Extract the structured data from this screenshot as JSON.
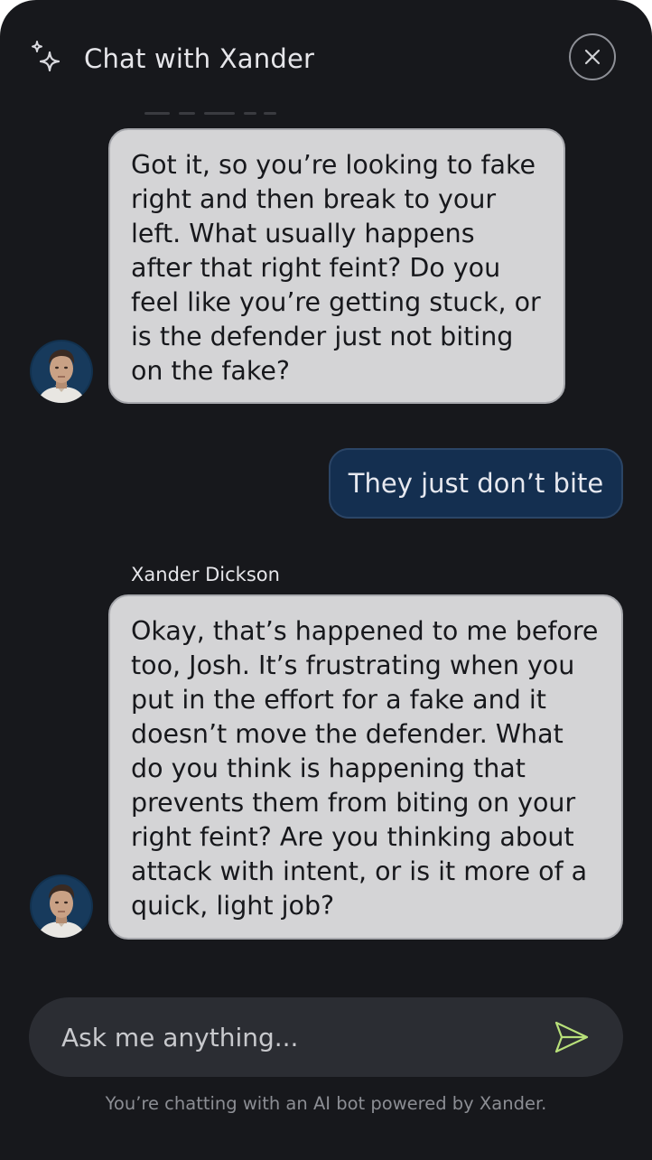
{
  "header": {
    "title": "Chat with Xander",
    "icon": "sparkle-icon",
    "close_icon": "close-icon"
  },
  "messages": [
    {
      "role": "bot",
      "text": "Got it, so you’re looking to fake right and then break to your left. What usually happens after that right feint? Do you feel like you’re getting stuck, or is the defender just not biting on the fake?"
    },
    {
      "role": "user",
      "text": "They just don’t bite"
    },
    {
      "role": "bot",
      "sender": "Xander Dickson",
      "text": "Okay, that’s happened to me before too, Josh. It’s frustrating when you put in the effort for a fake and it doesn’t move the defender. What do you think is happening that prevents them from biting on your right feint? Are you thinking about attack with intent, or is it more of a quick, light job?"
    }
  ],
  "input": {
    "placeholder": "Ask me anything...",
    "value": "",
    "send_icon": "send-icon"
  },
  "footer": "You’re chatting with an AI bot powered by Xander.",
  "colors": {
    "background": "#17181c",
    "bot_bubble": "#d4d4d6",
    "user_bubble": "#142f50",
    "send_accent": "#b8e07a"
  }
}
